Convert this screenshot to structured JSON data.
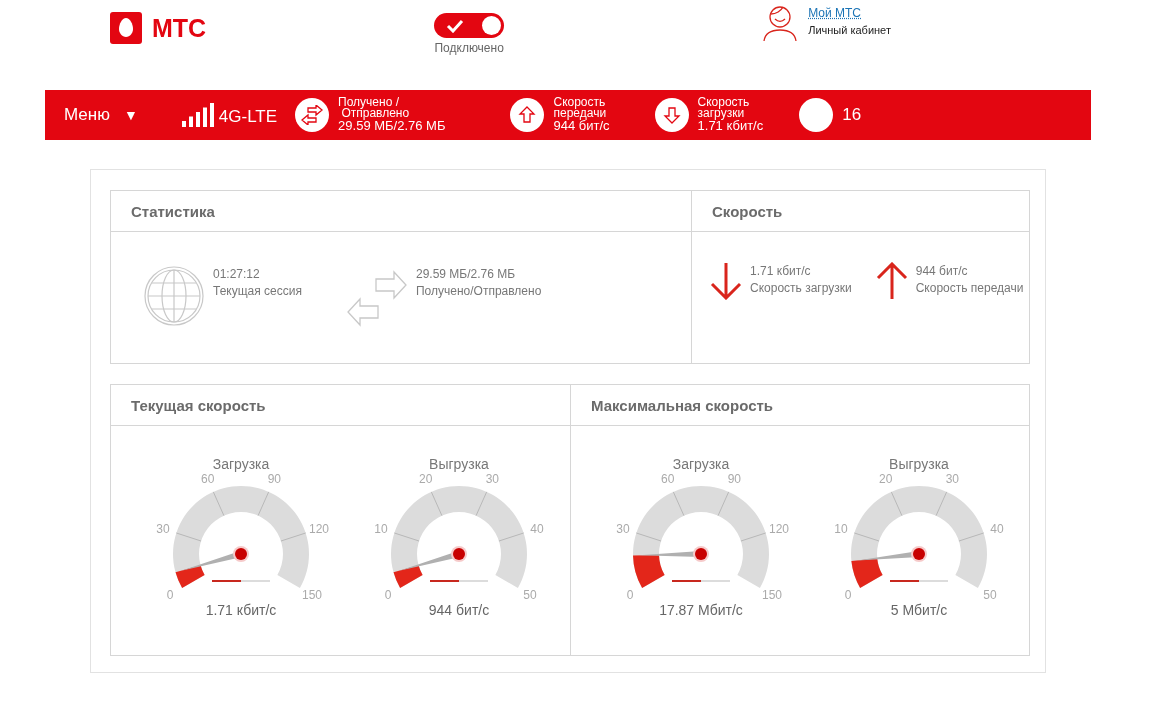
{
  "header": {
    "logo": "МТС",
    "connection": {
      "on": true,
      "status": "Подключено"
    },
    "account": {
      "link": "Мой МТС",
      "caption": "Личный кабинет"
    }
  },
  "nav_bar": {
    "menu": "Меню",
    "menu_caret": "▼",
    "network": "4G-LTE",
    "stats": [
      {
        "kind": "transfer",
        "label": "Получено /\n Отправлено",
        "value": "29.59 МБ/2.76 МБ"
      },
      {
        "kind": "upload",
        "label": "Скорость\nпередачи",
        "value": "944 бит/с"
      },
      {
        "kind": "download",
        "label": "Скорость\nзагрузки",
        "value": "1.71 кбит/с"
      }
    ],
    "count": "16"
  },
  "statistics": {
    "title": "Статистика",
    "session_time": "01:27:12",
    "session_label": "Текущая сессия",
    "traffic": "29.59 МБ/2.76 МБ",
    "traffic_label": "Получено/Отправлено"
  },
  "speed": {
    "title": "Скорость",
    "items": [
      {
        "kind": "download",
        "value": "1.71 кбит/с",
        "label": "Скорость загрузки"
      },
      {
        "kind": "upload",
        "value": "944 бит/с",
        "label": "Скорость передачи"
      }
    ]
  },
  "gauge_panels": [
    {
      "title": "Текущая скорость",
      "gauges": [
        {
          "title": "Загрузка",
          "ticks": [
            "0",
            "30",
            "60",
            "90",
            "120",
            "150"
          ],
          "level": 0.06,
          "value": "1.71 кбит/с"
        },
        {
          "title": "Выгрузка",
          "ticks": [
            "0",
            "10",
            "20",
            "30",
            "40",
            "50"
          ],
          "level": 0.06,
          "value": "944 бит/с"
        }
      ]
    },
    {
      "title": "Максимальная скорость",
      "gauges": [
        {
          "title": "Загрузка",
          "ticks": [
            "0",
            "30",
            "60",
            "90",
            "120",
            "150"
          ],
          "level": 0.12,
          "value": "17.87 Мбит/с"
        },
        {
          "title": "Выгрузка",
          "ticks": [
            "0",
            "10",
            "20",
            "30",
            "40",
            "50"
          ],
          "level": 0.1,
          "value": "5 Мбит/с"
        }
      ]
    }
  ]
}
